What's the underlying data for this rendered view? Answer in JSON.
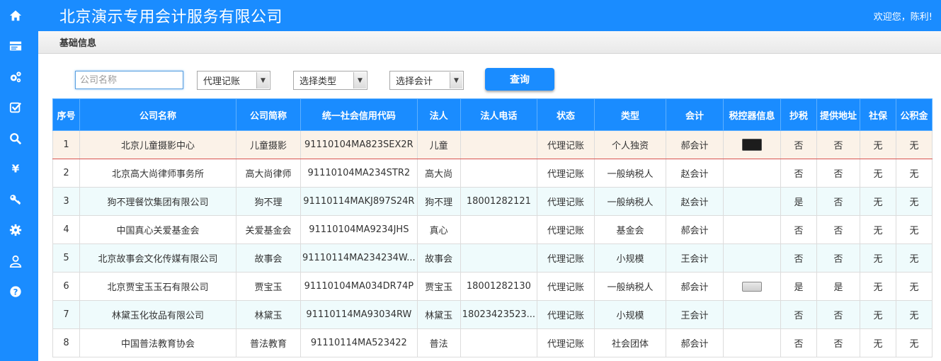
{
  "app": {
    "title": "北京演示专用会计服务有限公司",
    "welcome": "欢迎您，陈利!"
  },
  "section": {
    "title": "基础信息"
  },
  "sidebar": {
    "items": [
      {
        "icon": "home-icon"
      },
      {
        "icon": "card-icon"
      },
      {
        "icon": "gears-icon"
      },
      {
        "icon": "checkbox-icon"
      },
      {
        "icon": "search-icon"
      },
      {
        "icon": "yen-icon"
      },
      {
        "icon": "key-icon"
      },
      {
        "icon": "gear-icon"
      },
      {
        "icon": "user-icon"
      },
      {
        "icon": "help-icon"
      }
    ]
  },
  "filters": {
    "company_placeholder": "公司名称",
    "service_select": "代理记账",
    "type_select": "选择类型",
    "accountant_select": "选择会计",
    "query_label": "查询"
  },
  "table": {
    "headers": [
      "序号",
      "公司名称",
      "公司简称",
      "统一社会信用代码",
      "法人",
      "法人电话",
      "状态",
      "类型",
      "会计",
      "税控器信息",
      "抄税",
      "提供地址",
      "社保",
      "公积金"
    ],
    "rows": [
      [
        "1",
        "北京儿童摄影中心",
        "儿童摄影",
        "91110104MA823SEX2R",
        "儿童",
        "",
        "代理记账",
        "个人独资",
        "郝会计",
        "",
        "否",
        "否",
        "无",
        "无"
      ],
      [
        "2",
        "北京高大尚律师事务所",
        "高大尚律师",
        "91110104MA234STR2",
        "高大尚",
        "",
        "代理记账",
        "一般纳税人",
        "赵会计",
        "",
        "否",
        "否",
        "无",
        "无"
      ],
      [
        "3",
        "狗不理餐饮集团有限公司",
        "狗不理",
        "91110114MAKJ897S24R",
        "狗不理",
        "18001282121",
        "代理记账",
        "一般纳税人",
        "赵会计",
        "",
        "是",
        "否",
        "无",
        "无"
      ],
      [
        "4",
        "中国真心关爱基金会",
        "关爱基金会",
        "91110104MA9234JHS",
        "真心",
        "",
        "代理记账",
        "基金会",
        "郝会计",
        "",
        "否",
        "否",
        "无",
        "无"
      ],
      [
        "5",
        "北京故事会文化传媒有限公司",
        "故事会",
        "91110114MA234234W...",
        "故事会",
        "",
        "代理记账",
        "小规模",
        "王会计",
        "",
        "否",
        "否",
        "无",
        "无"
      ],
      [
        "6",
        "北京贾宝玉玉石有限公司",
        "贾宝玉",
        "91110104MA034DR74P",
        "贾宝玉",
        "18001282130",
        "代理记账",
        "一般纳税人",
        "郝会计",
        "",
        "是",
        "是",
        "无",
        "无"
      ],
      [
        "7",
        "林黛玉化妆品有限公司",
        "林黛玉",
        "91110114MA93034RW",
        "林黛玉",
        "18023423523...",
        "代理记账",
        "小规模",
        "王会计",
        "",
        "否",
        "否",
        "无",
        "无"
      ],
      [
        "8",
        "中国普法教育协会",
        "普法教育",
        "91110114MA523422",
        "普法",
        "",
        "代理记账",
        "社会团体",
        "郝会计",
        "",
        "否",
        "否",
        "无",
        "无"
      ]
    ],
    "tax_device": [
      "dark",
      "",
      "",
      "",
      "",
      "light",
      "",
      ""
    ]
  },
  "colors": {
    "primary": "#1a8cff",
    "selected_row": "#fbf2e8",
    "stripe": "#effbfc"
  }
}
